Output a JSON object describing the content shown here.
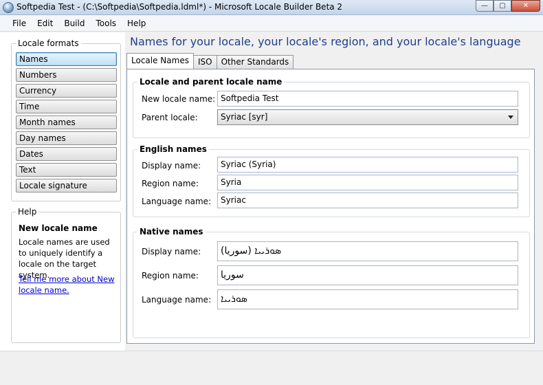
{
  "window": {
    "title": "Softpedia Test - (C:\\Softpedia\\Softpedia.ldml*) - Microsoft Locale Builder Beta 2",
    "buttons": {
      "minimize": "—",
      "maximize": "▢",
      "close": "✕"
    }
  },
  "menu": [
    "File",
    "Edit",
    "Build",
    "Tools",
    "Help"
  ],
  "sidebar": {
    "legend": "Locale formats",
    "items": [
      {
        "label": "Names",
        "active": true
      },
      {
        "label": "Numbers"
      },
      {
        "label": "Currency"
      },
      {
        "label": "Time"
      },
      {
        "label": "Month names"
      },
      {
        "label": "Day names"
      },
      {
        "label": "Dates"
      },
      {
        "label": "Text"
      },
      {
        "label": "Locale signature"
      }
    ]
  },
  "help": {
    "legend": "Help",
    "title": "New locale name",
    "body": "Locale names are used to uniquely identify a locale on the target system.",
    "link": "Tell me more about New locale name."
  },
  "main": {
    "title": "Names for your locale, your locale's region, and your locale's language",
    "tabs": [
      {
        "label": "Locale Names",
        "active": true
      },
      {
        "label": "ISO"
      },
      {
        "label": "Other Standards"
      }
    ],
    "locale_section": {
      "legend": "Locale and parent locale name",
      "new_locale_label": "New locale name:",
      "new_locale_value": "Softpedia Test",
      "parent_label": "Parent locale:",
      "parent_value": "Syriac [syr]"
    },
    "english_section": {
      "legend": "English names",
      "display_label": "Display name:",
      "display_value": "Syriac (Syria)",
      "region_label": "Region name:",
      "region_value": "Syria",
      "language_label": "Language name:",
      "language_value": "Syriac"
    },
    "native_section": {
      "legend": "Native names",
      "display_label": "Display name:",
      "display_value": "ܣܘܪܝܝܐ (سوريا)",
      "region_label": "Region name:",
      "region_value": "سوريا",
      "language_label": "Language name:",
      "language_value": "ܣܘܪܝܝܐ"
    }
  }
}
